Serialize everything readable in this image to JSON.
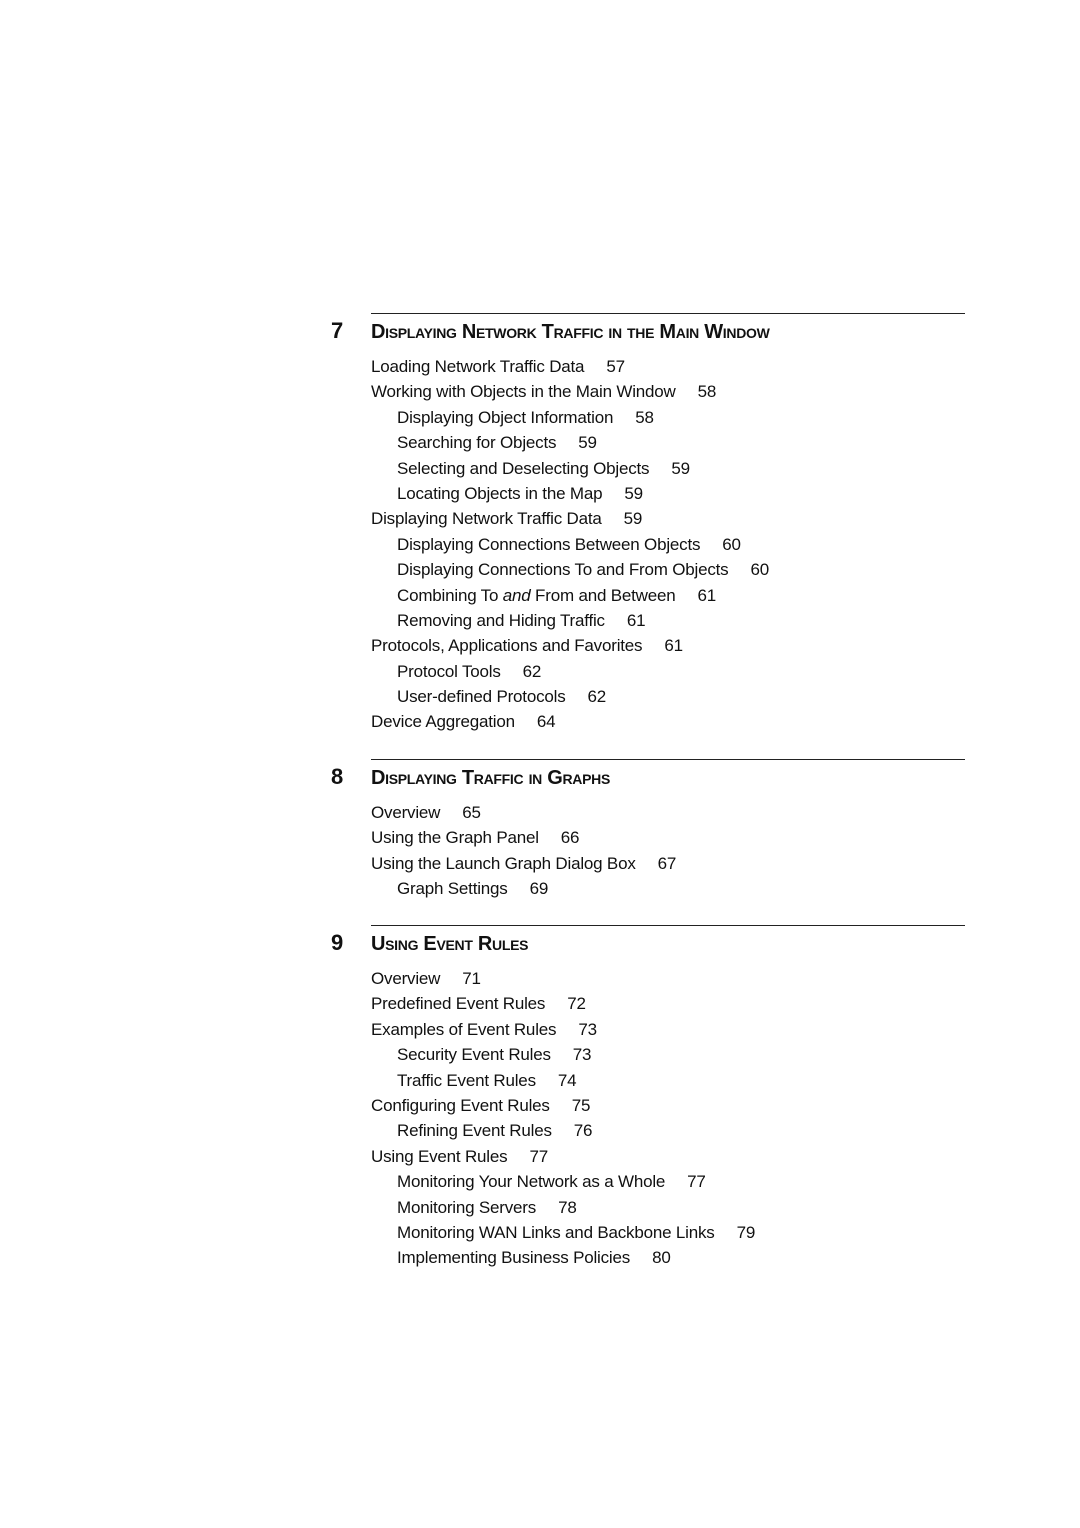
{
  "chapters": [
    {
      "number": "7",
      "title": "Displaying Network Traffic in the Main Window",
      "entries": [
        {
          "level": 1,
          "title": "Loading Network Traffic Data",
          "page": "57"
        },
        {
          "level": 1,
          "title": "Working with Objects in the Main Window",
          "page": "58"
        },
        {
          "level": 2,
          "title": "Displaying Object Information",
          "page": "58"
        },
        {
          "level": 2,
          "title": "Searching for Objects",
          "page": "59"
        },
        {
          "level": 2,
          "title": "Selecting and Deselecting Objects",
          "page": "59"
        },
        {
          "level": 2,
          "title": "Locating Objects in the Map",
          "page": "59"
        },
        {
          "level": 1,
          "title": "Displaying Network Traffic Data",
          "page": "59"
        },
        {
          "level": 2,
          "title": "Displaying Connections Between Objects",
          "page": "60"
        },
        {
          "level": 2,
          "title": "Displaying Connections To and From Objects",
          "page": "60"
        },
        {
          "level": 2,
          "title": "Combining To ",
          "title_em": "and",
          "title_post": " From and Between",
          "page": "61"
        },
        {
          "level": 2,
          "title": "Removing and Hiding Traffic",
          "page": "61"
        },
        {
          "level": 1,
          "title": "Protocols, Applications and Favorites",
          "page": "61"
        },
        {
          "level": 2,
          "title": "Protocol Tools",
          "page": "62"
        },
        {
          "level": 2,
          "title": "User-defined Protocols",
          "page": "62"
        },
        {
          "level": 1,
          "title": "Device Aggregation",
          "page": "64"
        }
      ]
    },
    {
      "number": "8",
      "title": "Displaying Traffic in Graphs",
      "entries": [
        {
          "level": 1,
          "title": "Overview",
          "page": "65"
        },
        {
          "level": 1,
          "title": "Using the Graph Panel",
          "page": "66"
        },
        {
          "level": 1,
          "title": "Using the Launch Graph Dialog Box",
          "page": "67"
        },
        {
          "level": 2,
          "title": "Graph Settings",
          "page": "69"
        }
      ]
    },
    {
      "number": "9",
      "title": "Using Event Rules",
      "entries": [
        {
          "level": 1,
          "title": "Overview",
          "page": "71"
        },
        {
          "level": 1,
          "title": "Predefined Event Rules",
          "page": "72"
        },
        {
          "level": 1,
          "title": "Examples of Event Rules",
          "page": "73"
        },
        {
          "level": 2,
          "title": "Security Event Rules",
          "page": "73"
        },
        {
          "level": 2,
          "title": "Traffic Event Rules",
          "page": "74"
        },
        {
          "level": 1,
          "title": "Configuring Event Rules",
          "page": "75"
        },
        {
          "level": 2,
          "title": "Refining Event Rules",
          "page": "76"
        },
        {
          "level": 1,
          "title": "Using Event Rules",
          "page": "77"
        },
        {
          "level": 2,
          "title": "Monitoring Your Network as a Whole",
          "page": "77"
        },
        {
          "level": 2,
          "title": "Monitoring Servers",
          "page": "78"
        },
        {
          "level": 2,
          "title": "Monitoring WAN Links and Backbone Links",
          "page": "79"
        },
        {
          "level": 2,
          "title": "Implementing Business Policies",
          "page": "80"
        }
      ]
    }
  ]
}
